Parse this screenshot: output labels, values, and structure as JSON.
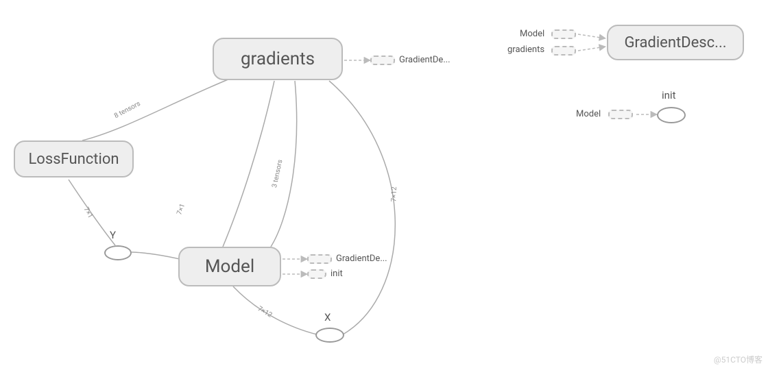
{
  "main_graph": {
    "nodes": {
      "gradients": {
        "label": "gradients"
      },
      "loss_function": {
        "label": "LossFunction"
      },
      "model": {
        "label": "Model"
      },
      "y": {
        "label": "Y"
      },
      "x": {
        "label": "X"
      }
    },
    "outputs_of_gradients": {
      "label": "GradientDe..."
    },
    "outputs_of_model": {
      "gradient_de": {
        "label": "GradientDe..."
      },
      "init": {
        "label": "init"
      }
    },
    "edge_labels": {
      "gradients_loss": "8 tensors",
      "gradients_model": "3 tensors",
      "gradients_x": "7×12",
      "model_y": "7×1",
      "model_x": "7×12",
      "loss_y": "7×1"
    }
  },
  "aux_graph": {
    "gradient_descent_node": {
      "label": "GradientDesc..."
    },
    "inputs": {
      "model": "Model",
      "gradients": "gradients"
    },
    "init_label": "init",
    "init_input": "Model"
  },
  "watermark": "@51CTO博客"
}
